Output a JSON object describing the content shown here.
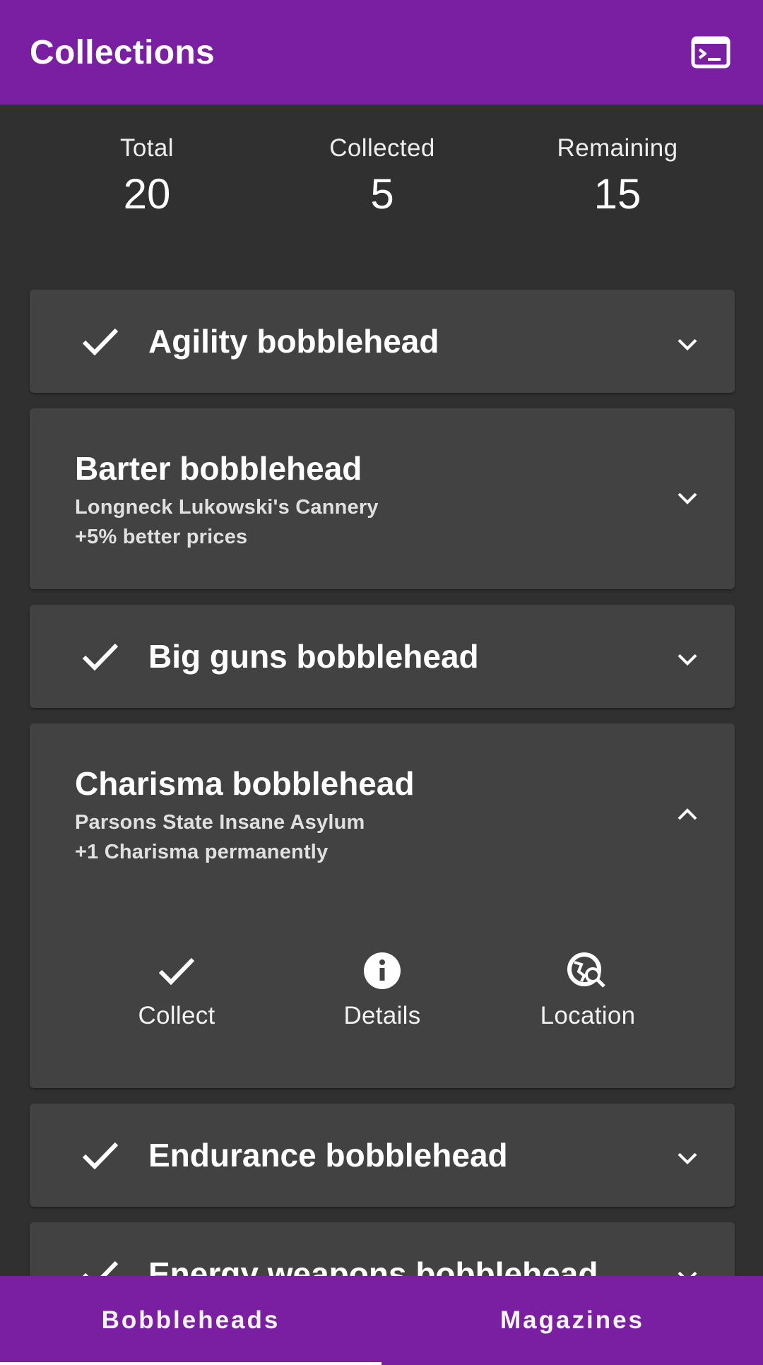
{
  "appbar": {
    "title": "Collections",
    "action_icon": "terminal-icon"
  },
  "stats": [
    {
      "label": "Total",
      "value": "20"
    },
    {
      "label": "Collected",
      "value": "5"
    },
    {
      "label": "Remaining",
      "value": "15"
    }
  ],
  "items": [
    {
      "title": "Agility bobblehead",
      "collected": true
    },
    {
      "title": "Barter bobblehead",
      "collected": false,
      "location": "Longneck Lukowski's Cannery",
      "effect": "+5% better prices"
    },
    {
      "title": "Big guns bobblehead",
      "collected": true
    },
    {
      "title": "Charisma bobblehead",
      "collected": false,
      "location": "Parsons State Insane Asylum",
      "effect": "+1 Charisma permanently",
      "expanded": true,
      "actions": [
        {
          "label": "Collect",
          "icon": "check-icon"
        },
        {
          "label": "Details",
          "icon": "info-icon"
        },
        {
          "label": "Location",
          "icon": "travel-explore-icon"
        }
      ]
    },
    {
      "title": "Endurance bobblehead",
      "collected": true
    },
    {
      "title": "Energy weapons bobblehead",
      "collected": true
    }
  ],
  "tabs": [
    {
      "label": "Bobbleheads",
      "selected": true
    },
    {
      "label": "Magazines",
      "selected": false
    }
  ],
  "colors": {
    "primary": "#7b1fa2",
    "background": "#303030",
    "card": "#424242"
  }
}
